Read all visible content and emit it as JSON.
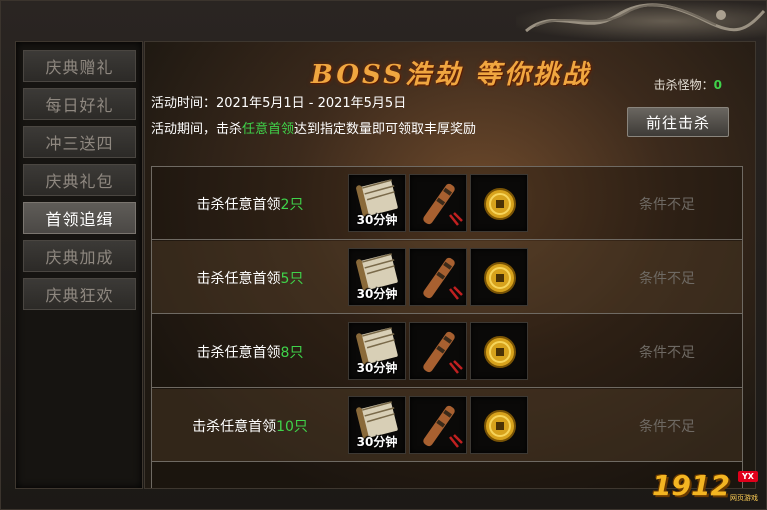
{
  "sidebar": {
    "items": [
      {
        "label": "庆典赠礼",
        "active": false
      },
      {
        "label": "每日好礼",
        "active": false
      },
      {
        "label": "冲三送四",
        "active": false
      },
      {
        "label": "庆典礼包",
        "active": false
      },
      {
        "label": "首领追缉",
        "active": true
      },
      {
        "label": "庆典加成",
        "active": false
      },
      {
        "label": "庆典狂欢",
        "active": false
      }
    ]
  },
  "main": {
    "title": "BOSS浩劫 等你挑战",
    "kill_label": "击杀怪物：",
    "kill_value": "0",
    "activity_time": "活动时间：2021年5月1日 - 2021年5月5日",
    "desc_before": "活动期间，击杀",
    "desc_highlight": "任意首领",
    "desc_after": "达到指定数量即可领取丰厚奖励",
    "go_button": "前往击杀"
  },
  "rows": [
    {
      "cond_prefix": "击杀任意首领",
      "count": "2只",
      "scroll_caption": "30分钟",
      "status": "条件不足"
    },
    {
      "cond_prefix": "击杀任意首领",
      "count": "5只",
      "scroll_caption": "30分钟",
      "status": "条件不足"
    },
    {
      "cond_prefix": "击杀任意首领",
      "count": "8只",
      "scroll_caption": "30分钟",
      "status": "条件不足"
    },
    {
      "cond_prefix": "击杀任意首领",
      "count": "10只",
      "scroll_caption": "30分钟",
      "status": "条件不足"
    }
  ],
  "reward_icons": [
    "scroll-icon",
    "firework-rocket-icon",
    "gold-coin-icon"
  ],
  "watermark": {
    "text": "1912",
    "badge": "YX",
    "sub": "网页游戏"
  },
  "colors": {
    "highlight": "#3fd34a",
    "title": "#f0a640",
    "disabled": "#6e6963"
  }
}
